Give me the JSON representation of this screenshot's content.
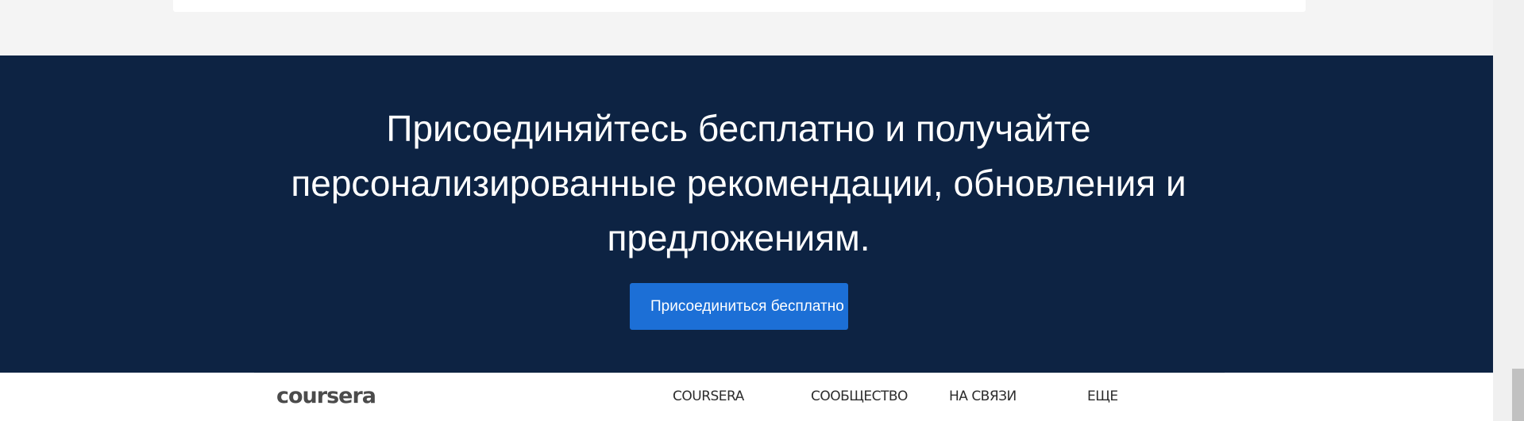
{
  "banner": {
    "headline_lines": [
      "Присоединяйтесь бесплатно и получайте",
      "персонализированные рекомендации, обновления и",
      "предложениям."
    ],
    "button_label": "Присоединиться бесплатно"
  },
  "footer": {
    "logo_text": "coursera",
    "nav": [
      "COURSERA",
      "СООБЩЕСТВО",
      "НА СВЯЗИ",
      "ЕЩЕ"
    ]
  },
  "colors": {
    "banner_bg": "#0d2343",
    "button_bg": "#1c6fd6",
    "page_bg": "#f4f4f4"
  }
}
